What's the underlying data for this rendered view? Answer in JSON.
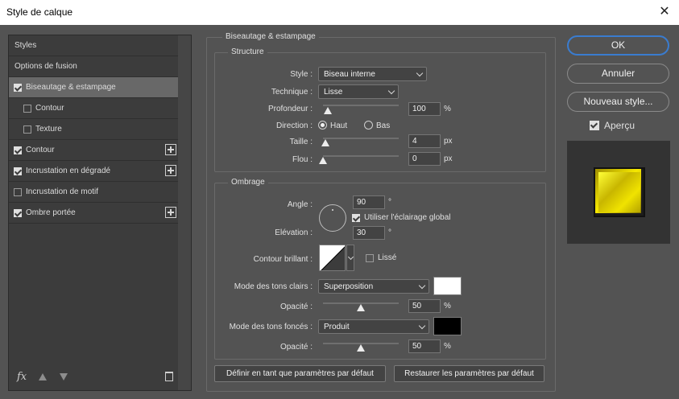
{
  "window": {
    "title": "Style de calque",
    "close_glyph": "✕"
  },
  "left_panel": {
    "items": [
      {
        "label": "Styles",
        "checkbox": null,
        "selected": false,
        "indent": false,
        "plus": false
      },
      {
        "label": "Options de fusion",
        "checkbox": null,
        "selected": false,
        "indent": false,
        "plus": false
      },
      {
        "label": "Biseautage & estampage",
        "checkbox": true,
        "selected": true,
        "indent": false,
        "plus": false
      },
      {
        "label": "Contour",
        "checkbox": false,
        "selected": false,
        "indent": true,
        "plus": false
      },
      {
        "label": "Texture",
        "checkbox": false,
        "selected": false,
        "indent": true,
        "plus": false
      },
      {
        "label": "Contour",
        "checkbox": true,
        "selected": false,
        "indent": false,
        "plus": true
      },
      {
        "label": "Incrustation en dégradé",
        "checkbox": true,
        "selected": false,
        "indent": false,
        "plus": true
      },
      {
        "label": "Incrustation de motif",
        "checkbox": false,
        "selected": false,
        "indent": false,
        "plus": false
      },
      {
        "label": "Ombre portée",
        "checkbox": true,
        "selected": false,
        "indent": false,
        "plus": true
      }
    ],
    "fx_label": "fx"
  },
  "main": {
    "section_title": "Biseautage & estampage",
    "structure": {
      "legend": "Structure",
      "style_label": "Style :",
      "style_value": "Biseau interne",
      "technique_label": "Technique :",
      "technique_value": "Lisse",
      "depth_label": "Profondeur :",
      "depth_value": "100",
      "depth_unit": "%",
      "depth_slider": 0.06,
      "direction_label": "Direction :",
      "direction_up": "Haut",
      "direction_down": "Bas",
      "size_label": "Taille :",
      "size_value": "4",
      "size_unit": "px",
      "size_slider": 0.03,
      "soften_label": "Flou :",
      "soften_value": "0",
      "soften_unit": "px",
      "soften_slider": 0.0
    },
    "shading": {
      "legend": "Ombrage",
      "angle_label": "Angle :",
      "angle_value": "90",
      "angle_unit": "°",
      "global_light_label": "Utiliser l'éclairage global",
      "altitude_label": "Elévation :",
      "altitude_value": "30",
      "altitude_unit": "°",
      "gloss_label": "Contour brillant :",
      "antialias_label": "Lissé",
      "highlight_label": "Mode des tons clairs :",
      "highlight_mode": "Superposition",
      "highlight_color": "#ffffff",
      "highlight_opacity_label": "Opacité :",
      "highlight_opacity": "50",
      "highlight_opacity_unit": "%",
      "highlight_opacity_slider": 0.5,
      "shadow_label": "Mode des tons foncés :",
      "shadow_mode": "Produit",
      "shadow_color": "#000000",
      "shadow_opacity_label": "Opacité :",
      "shadow_opacity": "50",
      "shadow_opacity_unit": "%",
      "shadow_opacity_slider": 0.5
    },
    "default_btn": "Définir en tant que paramètres par défaut",
    "reset_btn": "Restaurer les paramètres par défaut"
  },
  "right": {
    "ok": "OK",
    "cancel": "Annuler",
    "new_style": "Nouveau style...",
    "preview_label": "Aperçu"
  }
}
